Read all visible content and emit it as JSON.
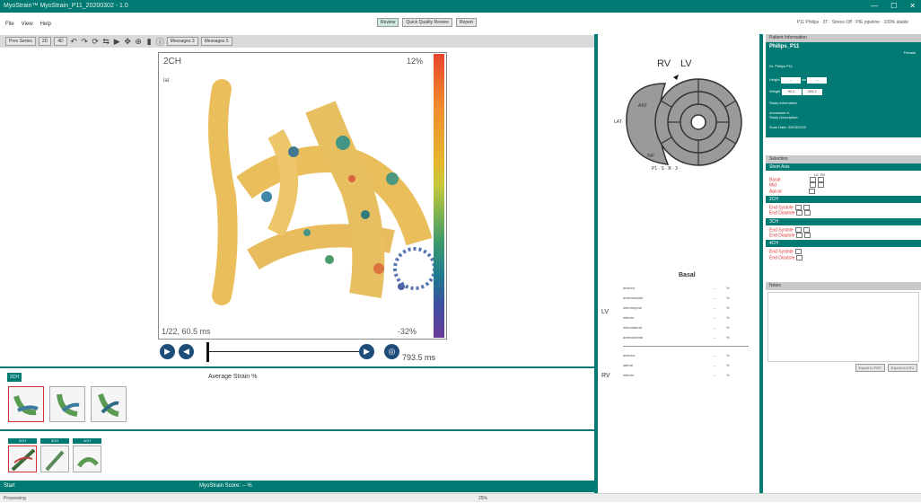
{
  "window": {
    "title": "MyoStrain™ MyoStrain_P11_20200302 - 1.0"
  },
  "menu": [
    "File",
    "View",
    "Help"
  ],
  "modes": {
    "review": "Review",
    "qa": "Quick Quality Review",
    "report": "Report"
  },
  "header_status": "P11 Philips · 3T · Stress Off · PIE pipeline · 100% stable",
  "toolbar": {
    "buttons": [
      "Prev Series",
      "2D",
      "4D",
      "Messages 3",
      "Messages 5"
    ]
  },
  "viewer": {
    "view_label": "2CH",
    "orientation": "lat",
    "max_label": "12%",
    "min_label": "-32%",
    "frame_label": "1/22, 60.5 ms",
    "end_time": "793.5 ms"
  },
  "strip": {
    "header_left": "2CH",
    "title": "Average Strain",
    "unit": "%"
  },
  "tabs": [
    "2CH",
    "3CH",
    "4CH"
  ],
  "bottom": {
    "left": "Start",
    "center": "MyoStrain Score: -- %"
  },
  "status": {
    "left": "Processing",
    "center": "25%"
  },
  "bullseye": {
    "rv": "RV",
    "lv": "LV",
    "ant": "ANT",
    "lat": "LAT",
    "inf": "INF",
    "caption": "P1 · S · B · 3 ·"
  },
  "segments": {
    "title": "Basal",
    "lv_label": "LV",
    "rv_label": "RV",
    "lv": [
      {
        "name": "anterior",
        "value": "--",
        "unit": "%"
      },
      {
        "name": "anteroseptal",
        "value": "--",
        "unit": "%"
      },
      {
        "name": "inferoseptal",
        "value": "--",
        "unit": "%"
      },
      {
        "name": "inferior",
        "value": "--",
        "unit": "%"
      },
      {
        "name": "inferolateral",
        "value": "--",
        "unit": "%"
      },
      {
        "name": "anterolateral",
        "value": "--",
        "unit": "%"
      }
    ],
    "rv": [
      {
        "name": "anterior",
        "value": "--",
        "unit": "%"
      },
      {
        "name": "lateral",
        "value": "--",
        "unit": "%"
      },
      {
        "name": "inferior",
        "value": "--",
        "unit": "%"
      }
    ]
  },
  "patient": {
    "header": "Patient Information",
    "name": "Philips_P11",
    "gender": "Female",
    "id_label": "Female",
    "age": "Female",
    "physician": "Dr. Philips P11",
    "height_label": "Height",
    "height_cm": "--",
    "height_unit": "cm",
    "height_in": "--",
    "weight_label": "Weight",
    "weight_kg": "92.2",
    "weight_lbs": "203.2",
    "study_header": "Study Information",
    "study_line1": "Accession #:",
    "study_line2": "Study Description:",
    "study_line3": "Scan Date:",
    "study_date": "03/03/2020"
  },
  "selection": {
    "header": "Selection",
    "short_axis": "Short Axis",
    "basal": "Basal",
    "mid": "Mid",
    "apical": "Apical",
    "ch2": "2CH",
    "ch3": "3CH",
    "ch4": "4CH",
    "lv": "LV",
    "rv": "RV",
    "end_systole": "End Systole",
    "end_diastole": "End Diastole"
  },
  "notes": {
    "header": "Notes"
  },
  "buttons": {
    "export_pdf": "Export to PDF",
    "export_csv": "Export to CSV"
  }
}
